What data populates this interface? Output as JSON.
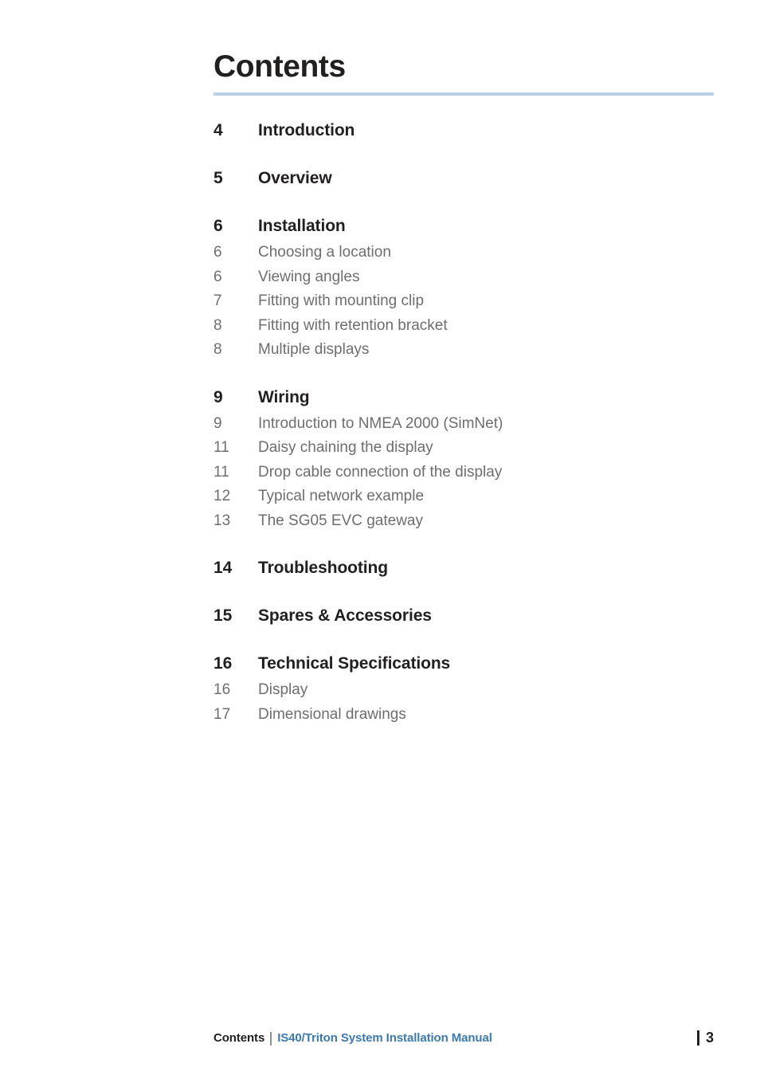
{
  "document": {
    "title": "Contents",
    "accent_rule_color": "#b9d0e6"
  },
  "toc": {
    "groups": [
      {
        "heading": {
          "page": "4",
          "label": "Introduction"
        },
        "items": []
      },
      {
        "heading": {
          "page": "5",
          "label": "Overview"
        },
        "items": []
      },
      {
        "heading": {
          "page": "6",
          "label": "Installation"
        },
        "items": [
          {
            "page": "6",
            "label": "Choosing a location"
          },
          {
            "page": "6",
            "label": "Viewing angles"
          },
          {
            "page": "7",
            "label": "Fitting with mounting clip"
          },
          {
            "page": "8",
            "label": "Fitting with retention bracket"
          },
          {
            "page": "8",
            "label": "Multiple displays"
          }
        ]
      },
      {
        "heading": {
          "page": "9",
          "label": "Wiring"
        },
        "items": [
          {
            "page": "9",
            "label": "Introduction to NMEA 2000 (SimNet)"
          },
          {
            "page": "11",
            "label": "Daisy chaining the display"
          },
          {
            "page": "11",
            "label": "Drop cable connection of the display"
          },
          {
            "page": "12",
            "label": "Typical network example"
          },
          {
            "page": "13",
            "label": "The SG05 EVC gateway"
          }
        ]
      },
      {
        "heading": {
          "page": "14",
          "label": "Troubleshooting"
        },
        "items": []
      },
      {
        "heading": {
          "page": "15",
          "label": "Spares & Accessories"
        },
        "items": []
      },
      {
        "heading": {
          "page": "16",
          "label": "Technical Specifications"
        },
        "items": [
          {
            "page": "16",
            "label": "Display"
          },
          {
            "page": "17",
            "label": "Dimensional drawings"
          }
        ]
      }
    ]
  },
  "footer": {
    "section": "Contents",
    "manual_title": "IS40/Triton System Installation Manual",
    "page_number": "3",
    "manual_title_color": "#3b7ab4"
  }
}
